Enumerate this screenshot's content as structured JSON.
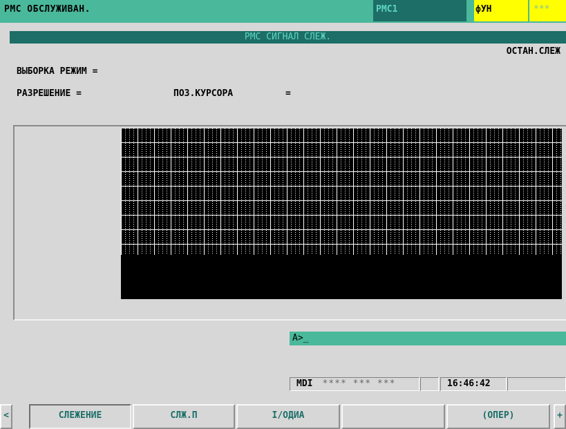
{
  "header": {
    "title": "PMC OБCЛУЖИBAH.",
    "path_tag": "PMC1",
    "func_tag": "фУH",
    "stars_tag": "***"
  },
  "screen": {
    "subtitle": "PMC CИГHAЛ CЛEЖ.",
    "status_right": "OCTAH.CЛEЖ",
    "fields": {
      "sampling_mode_label": "BЫБOPKA PEЖИM =",
      "resolution_label": "PAЗPEШEHИE =",
      "cursor_pos_label": "ПOЗ.KУPCOPA",
      "cursor_pos_eq": "="
    }
  },
  "command_line": {
    "prompt": "A>_"
  },
  "status": {
    "mode": "MDI",
    "mode_stars": "**** *** ***",
    "time": "16:46:42"
  },
  "softkeys": {
    "left_arrow": "<",
    "right_arrow": "+",
    "items": [
      {
        "label": "CЛEЖEHИE"
      },
      {
        "label": "CЛЖ.П"
      },
      {
        "label": "I/OДИA"
      },
      {
        "label": ""
      },
      {
        "label": "(OПEP)"
      }
    ]
  },
  "colors": {
    "accent": "#4ab89a",
    "dark_accent": "#1c6e67",
    "highlight": "#ffff00",
    "background": "#d7d7d7"
  }
}
